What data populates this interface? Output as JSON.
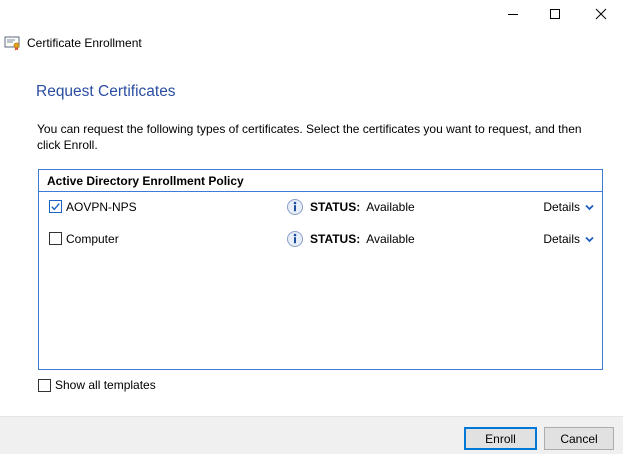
{
  "window": {
    "controls": [
      "minimize-icon",
      "maximize-icon",
      "close-icon"
    ]
  },
  "app": {
    "title": "Certificate Enrollment",
    "icon": "certificate-icon"
  },
  "main": {
    "heading": "Request Certificates",
    "intro": "You can request the following types of certificates. Select the certificates you want to request, and then click Enroll.",
    "policy": {
      "header": "Active Directory Enrollment Policy",
      "items": [
        {
          "name": "AOVPN-NPS",
          "checked": true,
          "status_label": "STATUS:",
          "status_value": "Available",
          "details_label": "Details",
          "icon": "info-icon"
        },
        {
          "name": "Computer",
          "checked": false,
          "status_label": "STATUS:",
          "status_value": "Available",
          "details_label": "Details",
          "icon": "info-icon"
        }
      ]
    },
    "show_all_templates": {
      "label": "Show all templates",
      "checked": false
    }
  },
  "footer": {
    "enroll_label": "Enroll",
    "cancel_label": "Cancel"
  },
  "colors": {
    "heading": "#2b4ea1",
    "border_accent": "#3e7bd6",
    "footer_bg": "#f0f0f0"
  }
}
